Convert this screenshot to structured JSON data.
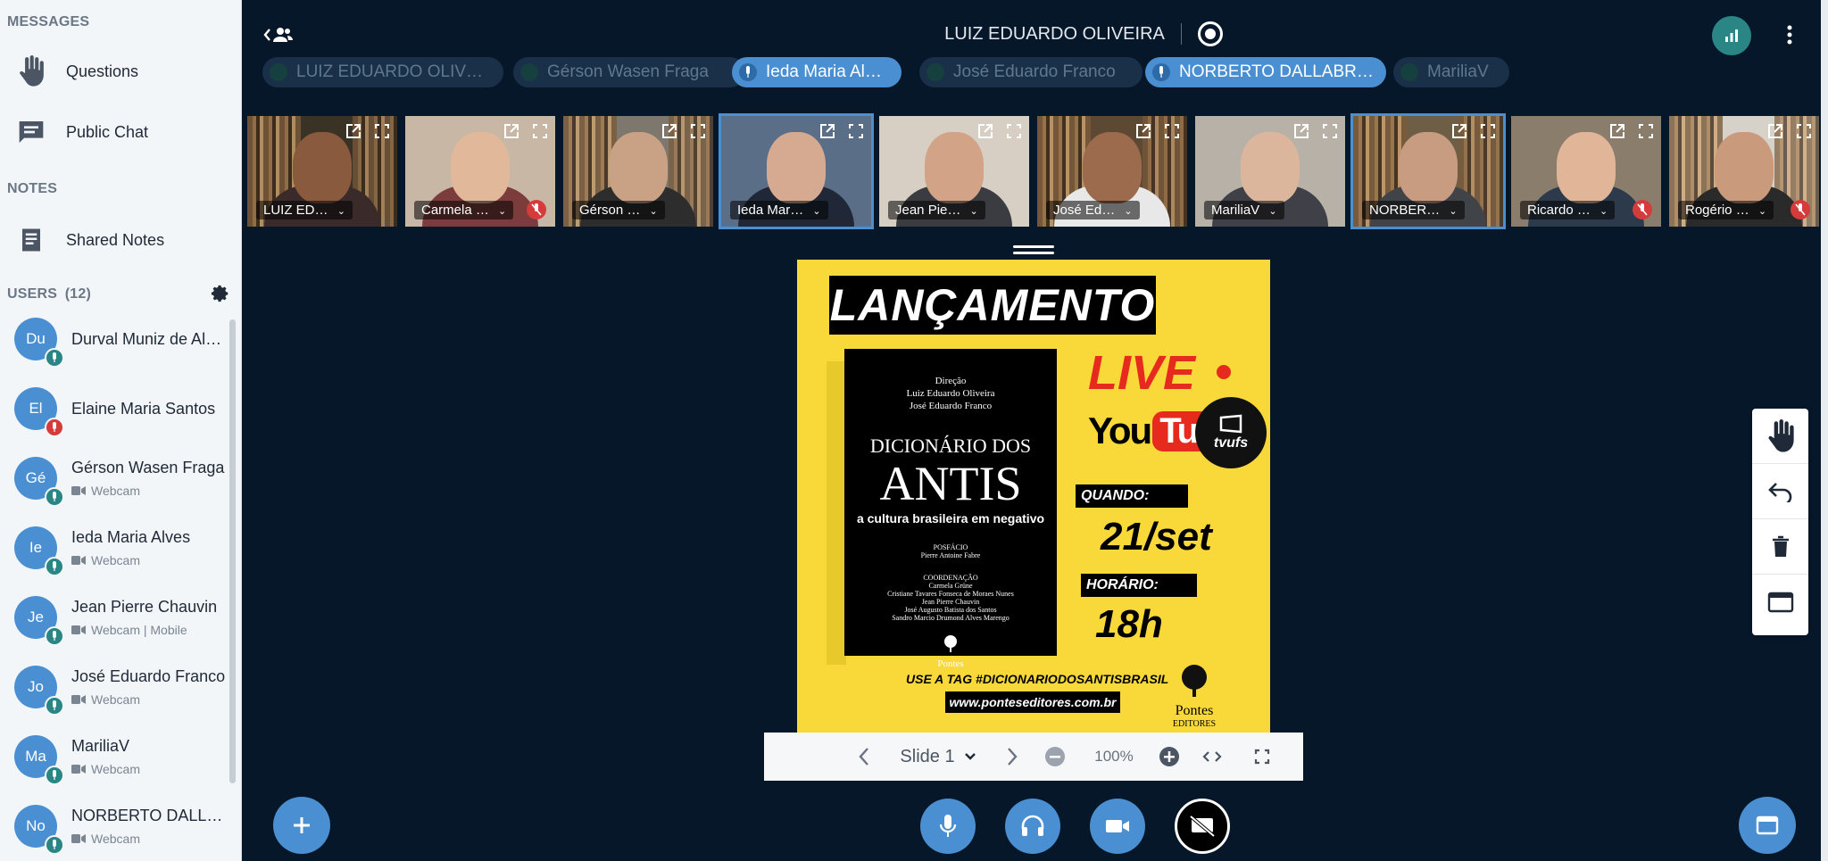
{
  "sidebar": {
    "messages_title": "MESSAGES",
    "questions_label": "Questions",
    "public_chat_label": "Public Chat",
    "notes_title": "NOTES",
    "shared_notes_label": "Shared Notes",
    "users_title": "USERS",
    "users_count": "(12)",
    "users": [
      {
        "initials": "Du",
        "name": "Durval Muniz de Alb…",
        "status": "",
        "mic": "on"
      },
      {
        "initials": "El",
        "name": "Elaine Maria Santos",
        "status": "",
        "mic": "muted"
      },
      {
        "initials": "Gé",
        "name": "Gérson Wasen Fraga",
        "status": "Webcam",
        "mic": "on"
      },
      {
        "initials": "Ie",
        "name": "Ieda Maria Alves",
        "status": "Webcam",
        "mic": "on"
      },
      {
        "initials": "Je",
        "name": "Jean Pierre Chauvin",
        "status": "Webcam | Mobile",
        "mic": "on"
      },
      {
        "initials": "Jo",
        "name": "José Eduardo Franco",
        "status": "Webcam",
        "mic": "on"
      },
      {
        "initials": "Ma",
        "name": "MariliaV",
        "status": "Webcam",
        "mic": "on"
      },
      {
        "initials": "No",
        "name": "NORBERTO DALLAB…",
        "status": "Webcam",
        "mic": "on"
      }
    ]
  },
  "header": {
    "title": "LUIZ EDUARDO OLIVEIRA"
  },
  "talkers": [
    {
      "name": "LUIZ EDUARDO OLIVE…",
      "active": false
    },
    {
      "name": "Gérson Wasen Fraga",
      "active": false
    },
    {
      "name": "Ieda Maria Alves",
      "active": true
    },
    {
      "name": "José Eduardo Franco",
      "active": false
    },
    {
      "name": "NORBERTO DALLABRI…",
      "active": true
    },
    {
      "name": "MariliaV",
      "active": false
    }
  ],
  "videos": [
    {
      "name": "LUIZ ED…",
      "muted": false,
      "talking": false
    },
    {
      "name": "Carmela …",
      "muted": true,
      "talking": false
    },
    {
      "name": "Gérson …",
      "muted": false,
      "talking": false
    },
    {
      "name": "Ieda Mar…",
      "muted": false,
      "talking": true
    },
    {
      "name": "Jean Pie…",
      "muted": false,
      "talking": false
    },
    {
      "name": "José Ed…",
      "muted": false,
      "talking": false
    },
    {
      "name": "MariliaV",
      "muted": false,
      "talking": false
    },
    {
      "name": "NORBER…",
      "muted": false,
      "talking": true
    },
    {
      "name": "Ricardo …",
      "muted": true,
      "talking": false
    },
    {
      "name": "Rogério …",
      "muted": true,
      "talking": false
    }
  ],
  "slide": {
    "heading": "LANÇAMENTO",
    "book": {
      "direction_label": "Direção",
      "director_1": "Luiz Eduardo Oliveira",
      "director_2": "José Eduardo Franco",
      "title_top": "DICIONÁRIO DOS",
      "title_main": "ANTIS",
      "subtitle": "a cultura brasileira em negativo",
      "posfacio_label": "POSFÁCIO",
      "posfacio_name": "Pierre Antoine Fabre",
      "coord_label": "COORDENAÇÃO",
      "coord_1": "Carmela Grüne",
      "coord_2": "Cristiane Tavares Fonseca de Moraes Nunes",
      "coord_3": "Jean Pierre Chauvin",
      "coord_4": "José Augusto Batista dos Santos",
      "coord_5": "Sandro Marcio Drumond Alves Marengo",
      "publisher": "Pontes"
    },
    "live": "LIVE",
    "you": "You",
    "tube": "Tube",
    "tvufs": "tvufs",
    "when_label": "QUANDO:",
    "when_value": "21/set",
    "time_label": "HORÁRIO:",
    "time_value": "18h",
    "tag": "USE A TAG  #DICIONARIODOSANTISBRASIL",
    "url": "www.ponteseditores.com.br",
    "pontes_name": "Pontes",
    "pontes_sub": "EDITORES"
  },
  "slide_toolbar": {
    "slide_label": "Slide 1",
    "zoom": "100%"
  },
  "colors": {
    "accent": "#4a8fd1",
    "muted": "#d53b3b",
    "mic_on": "#2a8585",
    "background": "#06172a",
    "slide_yellow": "#f9d93a"
  }
}
